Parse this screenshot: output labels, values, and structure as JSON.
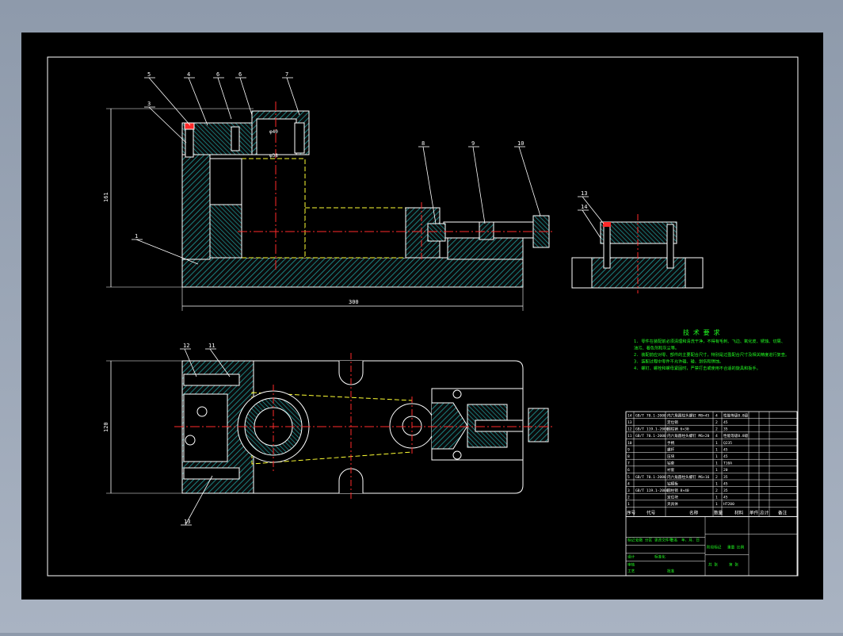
{
  "part_labels_top": [
    "5",
    "4",
    "6",
    "6",
    "7",
    "3",
    "1",
    "8",
    "9",
    "10"
  ],
  "part_labels_right": [
    "13",
    "14"
  ],
  "part_labels_bottom": [
    "12",
    "11",
    "13"
  ],
  "dimensions": {
    "height_label": "161",
    "width_label": "300",
    "slot_label": "φ40",
    "bore_label": "φ38",
    "plan_height_label": "120"
  },
  "tech_requirements": {
    "title": "技 术 要 求",
    "lines": [
      "1. 零件在装配前必须清理和清洗干净，不得有毛刺、飞边、氧化皮、锈蚀、切屑、",
      "   油污、着色剂和灰尘等。",
      "2. 装配前应对零、部件的主要配合尺寸，特别是过盈配合尺寸及相关精度进行复查。",
      "3. 装配过程中零件不允许磕、碰、划伤和锈蚀。",
      "4. 螺钉、螺栓和螺母紧固时，严禁打击或使用不合适的旋具和扳手。"
    ]
  },
  "bom": {
    "rows": [
      {
        "no": "14",
        "code": "GB/T 70.1-2000",
        "name": "内六角圆柱头螺钉 M8×45",
        "qty": "4",
        "mat": "性能等级8.8级"
      },
      {
        "no": "13",
        "code": "",
        "name": "定位销",
        "qty": "2",
        "mat": "45"
      },
      {
        "no": "12",
        "code": "GB/T 119.1-2000",
        "name": "圆柱销 6×30",
        "qty": "2",
        "mat": "35"
      },
      {
        "no": "11",
        "code": "GB/T 70.1-2000",
        "name": "内六角圆柱头螺钉 M6×20",
        "qty": "4",
        "mat": "性能等级8.8级"
      },
      {
        "no": "10",
        "code": "",
        "name": "手柄",
        "qty": "1",
        "mat": "Q235"
      },
      {
        "no": "9",
        "code": "",
        "name": "螺杆",
        "qty": "1",
        "mat": "45"
      },
      {
        "no": "8",
        "code": "",
        "name": "压块",
        "qty": "1",
        "mat": "45"
      },
      {
        "no": "7",
        "code": "",
        "name": "钻套",
        "qty": "1",
        "mat": "T10A"
      },
      {
        "no": "6",
        "code": "",
        "name": "衬套",
        "qty": "1",
        "mat": "20"
      },
      {
        "no": "5",
        "code": "GB/T 70.1-2000",
        "name": "内六角圆柱头螺钉 M6×16",
        "qty": "2",
        "mat": "35"
      },
      {
        "no": "4",
        "code": "",
        "name": "钻模板",
        "qty": "1",
        "mat": "45"
      },
      {
        "no": "3",
        "code": "GB/T 119.1-2000",
        "name": "圆柱销 8×40",
        "qty": "2",
        "mat": "35"
      },
      {
        "no": "2",
        "code": "",
        "name": "定位块",
        "qty": "1",
        "mat": "45"
      },
      {
        "no": "1",
        "code": "",
        "name": "夹具体",
        "qty": "1",
        "mat": "HT200"
      }
    ],
    "header": {
      "no": "序号",
      "code": "代号",
      "name": "名称",
      "qty": "数量",
      "mat": "材料",
      "weight_single": "单件",
      "weight_total": "总计",
      "remarks": "备注"
    },
    "title_block": [
      "标记",
      "处数",
      "分区",
      "更改文件号",
      "签名",
      "年、月、日",
      "设计",
      "标准化",
      "阶段标记",
      "重量",
      "比例",
      "审核",
      "工艺",
      "批准",
      "共 张",
      "第 张"
    ]
  },
  "colors": {
    "page_bg": "#000000",
    "outline": "#ffffff",
    "hatch": "#1e9d9d",
    "centerline": "#ff2a2a",
    "hidden_line": "#ffff33",
    "requirement_text": "#22ff22",
    "dim_text": "#ffffff"
  }
}
